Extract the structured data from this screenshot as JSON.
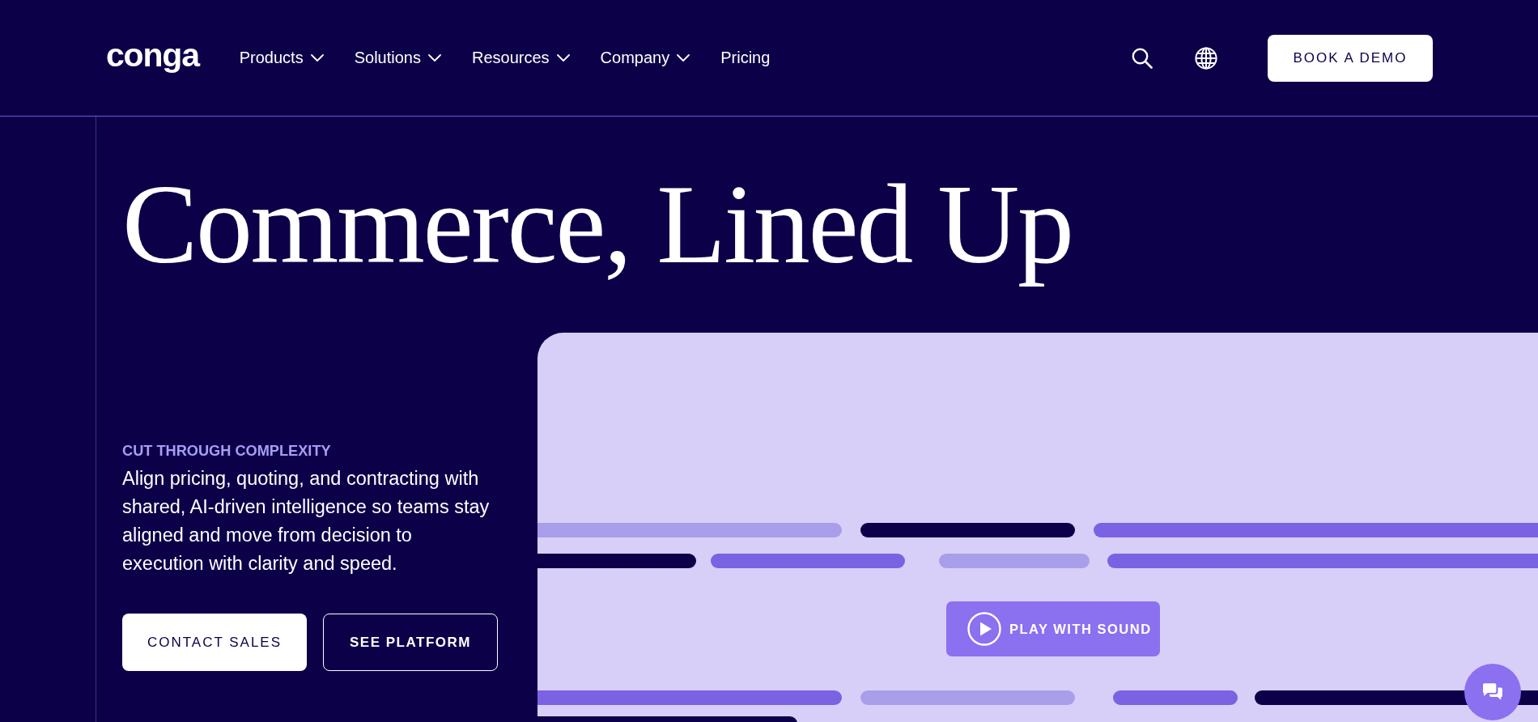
{
  "header": {
    "logo": "conga",
    "nav": [
      {
        "label": "Products",
        "dropdown": true
      },
      {
        "label": "Solutions",
        "dropdown": true
      },
      {
        "label": "Resources",
        "dropdown": true
      },
      {
        "label": "Company",
        "dropdown": true
      },
      {
        "label": "Pricing",
        "dropdown": false
      }
    ],
    "cta": "BOOK A DEMO"
  },
  "hero": {
    "title": "Commerce, Lined Up",
    "eyebrow": "CUT THROUGH COMPLEXITY",
    "description": "Align pricing, quoting, and contracting with shared, AI-driven intelligence so teams stay aligned and move from decision to execution with clarity and speed.",
    "buttons": [
      {
        "label": "CONTACT SALES",
        "kind": "primary"
      },
      {
        "label": "SEE PLATFORM",
        "kind": "outline"
      }
    ]
  },
  "video": {
    "play_button": "PLAY WITH SOUND"
  }
}
